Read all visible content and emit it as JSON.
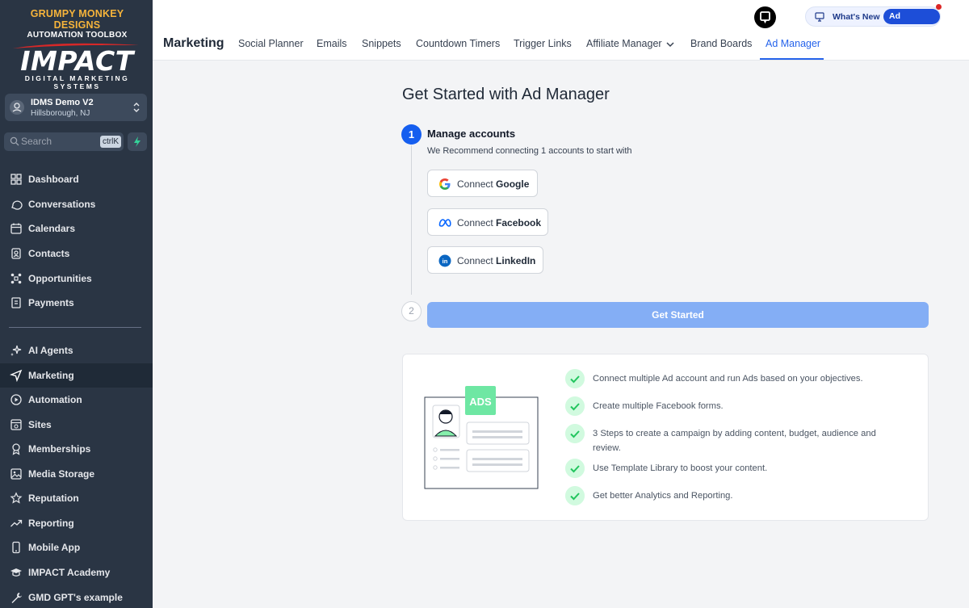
{
  "brand": {
    "line1": "GRUMPY MONKEY DESIGNS",
    "line2": "AUTOMATION TOOLBOX",
    "line3": "IMPACT",
    "line4": "DIGITAL MARKETING SYSTEMS"
  },
  "account": {
    "name": "IDMS Demo V2",
    "location": "Hillsborough, NJ"
  },
  "search": {
    "placeholder": "Search",
    "shortcut": "ctrlK"
  },
  "sidebar": {
    "items": [
      {
        "label": "Dashboard",
        "icon": "dashboard-icon"
      },
      {
        "label": "Conversations",
        "icon": "chat-bubble-icon"
      },
      {
        "label": "Calendars",
        "icon": "calendar-icon"
      },
      {
        "label": "Contacts",
        "icon": "contacts-icon"
      },
      {
        "label": "Opportunities",
        "icon": "opportunities-icon"
      },
      {
        "label": "Payments",
        "icon": "payments-icon"
      },
      {
        "label": "AI Agents",
        "icon": "sparkles-icon"
      },
      {
        "label": "Marketing",
        "icon": "paper-plane-icon",
        "active": true
      },
      {
        "label": "Automation",
        "icon": "automation-icon"
      },
      {
        "label": "Sites",
        "icon": "sites-icon"
      },
      {
        "label": "Memberships",
        "icon": "memberships-icon"
      },
      {
        "label": "Media Storage",
        "icon": "image-icon"
      },
      {
        "label": "Reputation",
        "icon": "star-icon"
      },
      {
        "label": "Reporting",
        "icon": "trend-icon"
      },
      {
        "label": "Mobile App",
        "icon": "mobile-icon"
      },
      {
        "label": "IMPACT Academy",
        "icon": "graduation-cap-icon"
      },
      {
        "label": "GMD GPT's example",
        "icon": "wrench-icon"
      }
    ]
  },
  "topbar": {
    "whats_new": "What's New",
    "ad_manager_badge": "Ad Manager",
    "crumb": "Marketing",
    "tabs": [
      {
        "label": "Social Planner"
      },
      {
        "label": "Emails"
      },
      {
        "label": "Snippets"
      },
      {
        "label": "Countdown Timers"
      },
      {
        "label": "Trigger Links"
      },
      {
        "label": "Affiliate Manager"
      },
      {
        "label": "Brand Boards"
      },
      {
        "label": "Ad Manager",
        "active": true
      }
    ]
  },
  "main": {
    "title": "Get Started with Ad Manager",
    "step1": {
      "number": "1",
      "title": "Manage accounts",
      "subtitle": "We Recommend connecting 1 accounts to start with"
    },
    "connect": [
      {
        "prefix": "Connect",
        "name": "Google",
        "icon": "google-icon"
      },
      {
        "prefix": "Connect",
        "name": "Facebook",
        "icon": "meta-icon"
      },
      {
        "prefix": "Connect",
        "name": "LinkedIn",
        "icon": "linkedin-icon"
      }
    ],
    "step2": {
      "number": "2"
    },
    "get_started": "Get Started",
    "illustration_label": "ADS",
    "features": [
      "Connect multiple Ad account and run Ads based on your objectives.",
      "Create multiple Facebook forms.",
      "3 Steps to create a campaign by adding content, budget, audience and review.",
      "Use Template Library to boost your content.",
      "Get better Analytics and Reporting."
    ]
  },
  "colors": {
    "sidebar_bg": "#2a3544",
    "accent": "#2563eb",
    "get_started_bg": "#84aef5",
    "check_bg": "#d1fadf",
    "check_stroke": "#22c55e"
  }
}
